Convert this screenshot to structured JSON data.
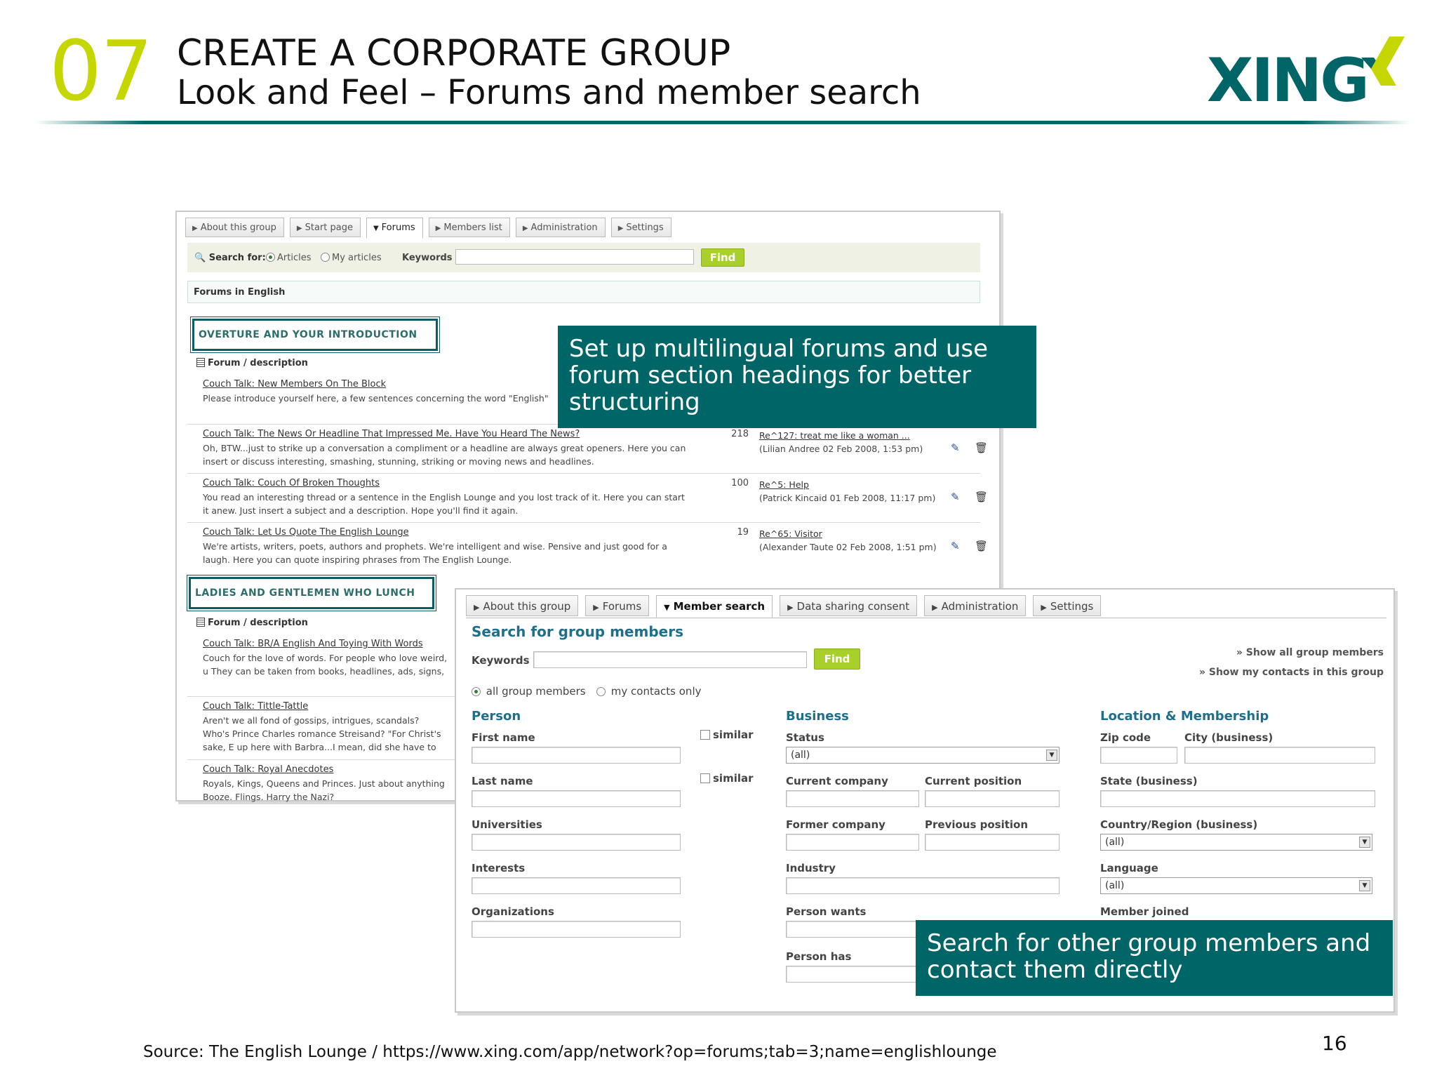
{
  "header": {
    "number": "07",
    "title": "CREATE A CORPORATE GROUP",
    "subtitle": "Look and Feel – Forums and member search",
    "logo_text": "XING",
    "colors": {
      "number": "#c6d600",
      "brand": "#006567"
    }
  },
  "forums_screen": {
    "tabs": [
      {
        "label": "About this group",
        "active": false
      },
      {
        "label": "Start page",
        "active": false
      },
      {
        "label": "Forums",
        "active": true
      },
      {
        "label": "Members list",
        "active": false
      },
      {
        "label": "Administration",
        "active": false
      },
      {
        "label": "Settings",
        "active": false
      }
    ],
    "search": {
      "label": "Search for:",
      "option_articles": "Articles",
      "option_my_articles": "My articles",
      "keywords_label": "Keywords",
      "keywords_value": "",
      "find": "Find"
    },
    "forums_bar": "Forums in English",
    "sections": [
      {
        "heading": "OVERTURE AND YOUR INTRODUCTION",
        "column_header": "Forum / description",
        "rows": [
          {
            "title": "Couch Talk: New Members On The Block",
            "desc": "Please introduce yourself here, a few sentences concerning the word \"English\"",
            "count": "",
            "last_link": "",
            "last_meta": ""
          },
          {
            "title": "Couch Talk: The News Or Headline That Impressed Me. Have You Heard The News?",
            "desc": "Oh, BTW...just to strike up a conversation a compliment or a headline are always great openers. Here you can insert or discuss interesting, smashing, stunning, striking or moving news and headlines.",
            "count": "218",
            "last_link": "Re^127: treat me like a woman ...",
            "last_meta": "(Lilian Andree 02 Feb 2008, 1:53 pm)"
          },
          {
            "title": "Couch Talk: Couch Of Broken Thoughts",
            "desc": "You read an interesting thread or a sentence in the English Lounge and you lost track of it. Here you can start it anew. Just insert a subject and a description. Hope you'll find it again.",
            "count": "100",
            "last_link": "Re^5: Help",
            "last_meta": "(Patrick Kincaid 01 Feb 2008, 11:17 pm)"
          },
          {
            "title": "Couch Talk: Let Us Quote The English Lounge",
            "desc": "We're artists, writers, poets, authors and prophets. We're intelligent and wise. Pensive and just good for a laugh. Here you can quote inspiring phrases from The English Lounge.",
            "count": "19",
            "last_link": "Re^65: Visitor",
            "last_meta": "(Alexander Taute 02 Feb 2008, 1:51 pm)"
          }
        ]
      },
      {
        "heading": "LADIES AND GENTLEMEN WHO LUNCH",
        "column_header": "Forum / description",
        "rows": [
          {
            "title": "Couch Talk: BR/A English And Toying With Words",
            "desc": "Couch for the love of words. For people who love weird, u They can be taken from books, headlines, ads, signs, T-"
          },
          {
            "title": "Couch Talk: Tittle-Tattle",
            "desc": "Aren't we all fond of gossips, intrigues, scandals? Who's Prince Charles romance Streisand? \"For Christ's sake, E up here with Barbra...I mean, did she have to stay overni"
          },
          {
            "title": "Couch Talk: Royal Anecdotes",
            "desc": "Royals, Kings, Queens and Princes. Just about anything Booze. Flings. Harry the Nazi?"
          }
        ]
      }
    ]
  },
  "member_screen": {
    "tabs": [
      {
        "label": "About this group",
        "active": false
      },
      {
        "label": "Forums",
        "active": false
      },
      {
        "label": "Member search",
        "active": true
      },
      {
        "label": "Data sharing consent",
        "active": false
      },
      {
        "label": "Administration",
        "active": false
      },
      {
        "label": "Settings",
        "active": false
      }
    ],
    "title": "Search for group members",
    "keywords_label": "Keywords",
    "keywords_value": "",
    "find": "Find",
    "links": [
      "» Show all group members",
      "» Show my contacts in this group"
    ],
    "scope_all": "all group members",
    "scope_contacts": "my contacts only",
    "person": {
      "title": "Person",
      "first_name": "First name",
      "last_name": "Last name",
      "similar": "similar",
      "universities": "Universities",
      "interests": "Interests",
      "organizations": "Organizations"
    },
    "business": {
      "title": "Business",
      "status": "Status",
      "status_value": "(all)",
      "current_company": "Current company",
      "current_position": "Current position",
      "former_company": "Former company",
      "previous_position": "Previous position",
      "industry": "Industry",
      "person_wants": "Person wants",
      "person_has": "Person has"
    },
    "location": {
      "title": "Location & Membership",
      "zip": "Zip code",
      "city": "City (business)",
      "state": "State (business)",
      "country": "Country/Region (business)",
      "country_value": "(all)",
      "language": "Language",
      "language_value": "(all)",
      "member_joined": "Member joined"
    }
  },
  "callouts": {
    "forums": "Set up multilingual forums and use forum section headings for better structuring",
    "members": "Search for other group members and contact them directly"
  },
  "footer": {
    "source": "Source: The English Lounge / https://www.xing.com/app/network?op=forums;tab=3;name=englishlounge",
    "page": "16"
  }
}
